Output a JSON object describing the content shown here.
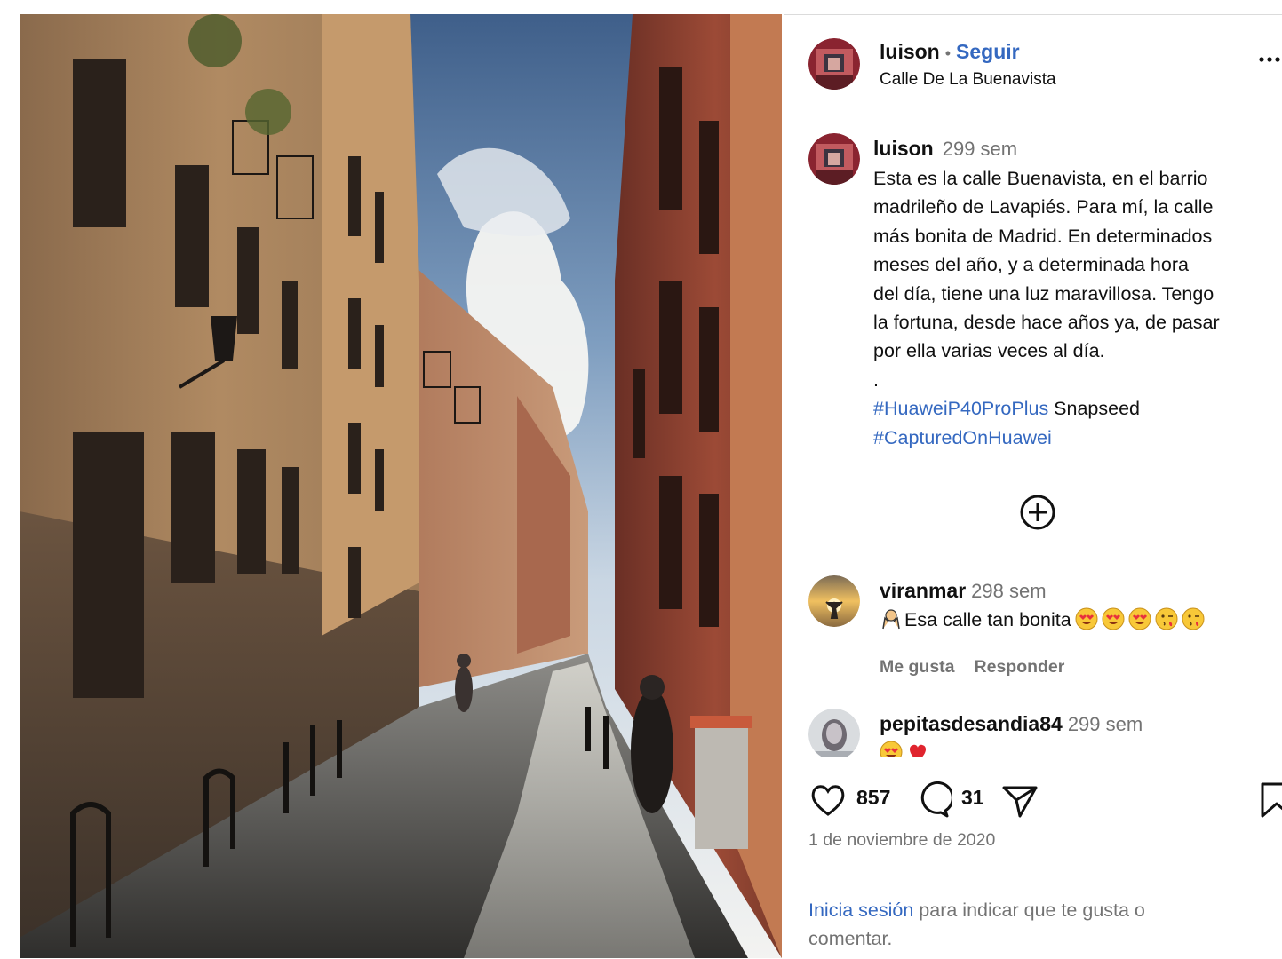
{
  "post": {
    "username": "luison",
    "follow_label": "Seguir",
    "separator": "•",
    "location": "Calle De La Buenavista",
    "more_icon": "more-horizontal-icon"
  },
  "caption": {
    "username": "luison",
    "time": "299 sem",
    "text": "Esta es la calle Buenavista, en el barrio\nmadrileño de Lavapiés. Para mí, la calle\nmás bonita de Madrid. En determinados\nmeses del año, y a determinada hora\ndel día, tiene una luz maravillosa. Tengo\nla fortuna, desde hace años ya, de pasar\npor ella varias veces al día.\n.",
    "hashtag1": "#HuaweiP40ProPlus",
    "plain1": " Snapseed",
    "hashtag2": "#CapturedOnHuawei"
  },
  "load_more_icon": "plus-circle-icon",
  "comments": [
    {
      "username": "viranmar",
      "time": "298 sem",
      "text": "Esa calle tan bonita",
      "emojis": [
        "hands-icon",
        "heart-eyes-icon",
        "heart-eyes-icon",
        "heart-eyes-icon",
        "kiss-wink-icon",
        "kiss-wink-icon"
      ],
      "like_label": "Me gusta",
      "reply_label": "Responder"
    },
    {
      "username": "pepitasdesandia84",
      "time": "299 sem",
      "emojis": [
        "heart-eyes-icon",
        "red-heart-icon"
      ]
    }
  ],
  "stats": {
    "likes": "857",
    "comments": "31"
  },
  "date": "1 de noviembre de 2020",
  "login": {
    "link": "Inicia sesión",
    "text": " para indicar que te gusta o comentar."
  },
  "colors": {
    "link": "#3468c0",
    "muted": "#737373",
    "border": "#dbdbdb"
  }
}
